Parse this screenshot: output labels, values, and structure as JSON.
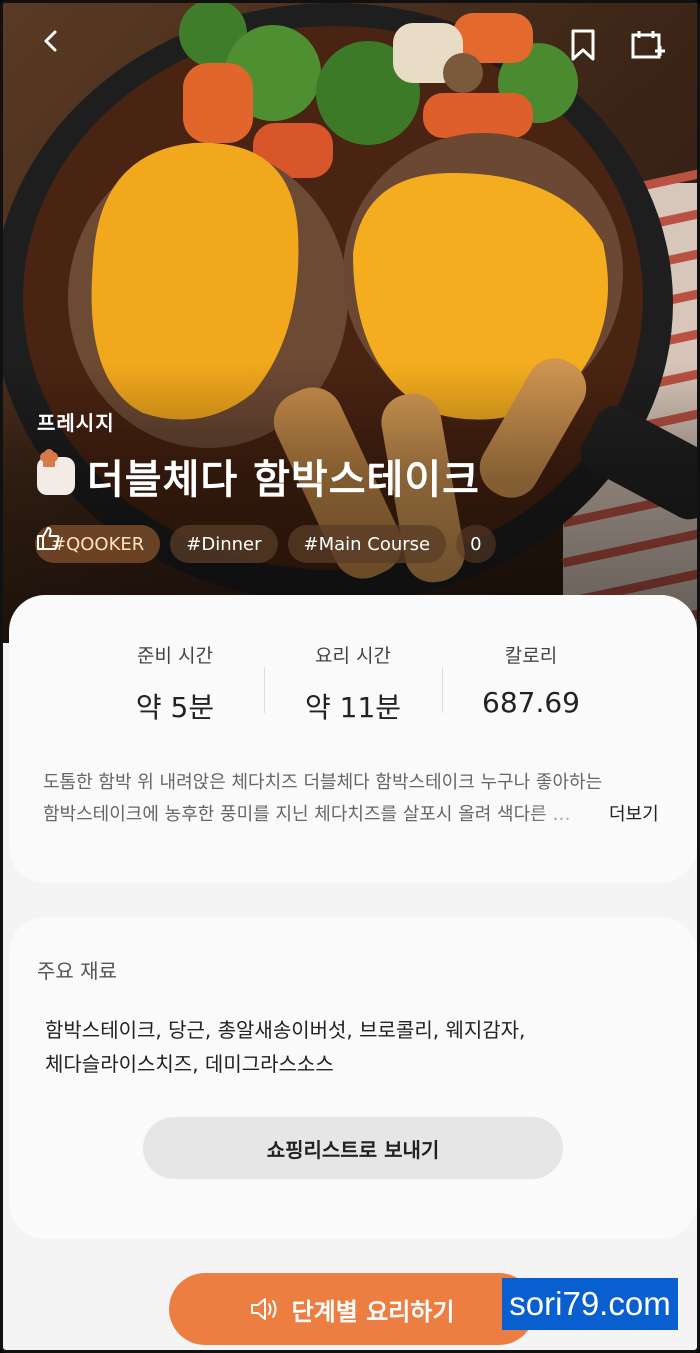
{
  "header": {
    "back_icon": "chevron-left-icon",
    "bookmark_icon": "bookmark-icon",
    "calendar_icon": "calendar-add-icon"
  },
  "recipe": {
    "brand": "프레시지",
    "title": "더블체다 함박스테이크",
    "tags": [
      "#QOOKER",
      "#Dinner",
      "#Main Course"
    ],
    "likes": "0"
  },
  "stats": [
    {
      "label": "준비 시간",
      "value": "약 5분"
    },
    {
      "label": "요리 시간",
      "value": "약 11분"
    },
    {
      "label": "칼로리",
      "value": "687.69"
    }
  ],
  "description": {
    "line1": "도톰한 함박 위 내려앉은 체다치즈 더블체다 함박스테이크 누구나 좋아하는",
    "line2": "함박스테이크에 농후한 풍미를 지닌 체다치즈를 살포시 올려 색다른 …",
    "more_label": "더보기"
  },
  "ingredients": {
    "title": "주요 재료",
    "line1": "함박스테이크, 당근, 총알새송이버섯, 브로콜리, 웨지감자,",
    "line2": "체다슬라이스치즈, 데미그라스소스",
    "shop_label": "쇼핑리스트로 보내기"
  },
  "cta": {
    "label": "단계별 요리하기",
    "icon": "speaker-icon"
  },
  "watermark": "sori79.com",
  "colors": {
    "accent": "#ec7e42",
    "card": "#fafafa",
    "watermark_bg": "#0a5fd0"
  }
}
